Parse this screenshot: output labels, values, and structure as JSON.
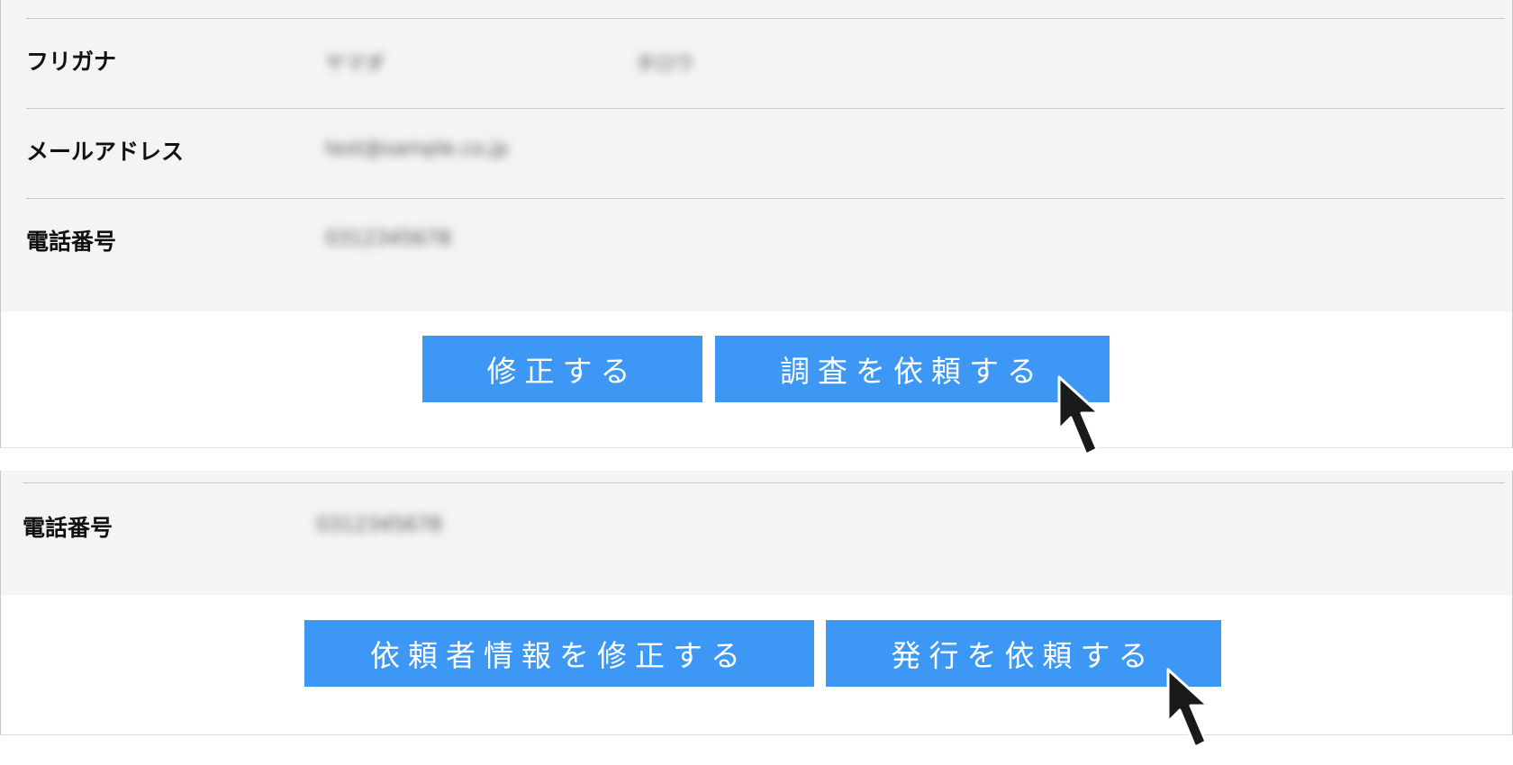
{
  "top_panel": {
    "rows": [
      {
        "label": "フリガナ",
        "value_1": "ヤマダ",
        "value_2": "タロウ"
      },
      {
        "label": "メールアドレス",
        "value_1": "test@sample.co.jp"
      },
      {
        "label": "電話番号",
        "value_1": "0312345678"
      }
    ],
    "buttons": {
      "edit_label": "修正する",
      "request_survey_label": "調査を依頼する"
    }
  },
  "bottom_panel": {
    "rows": [
      {
        "label": "電話番号",
        "value_1": "0312345678"
      }
    ],
    "buttons": {
      "edit_requester_label": "依頼者情報を修正する",
      "request_issue_label": "発行を依頼する"
    }
  },
  "colors": {
    "button_bg": "#3d98f5",
    "info_bg": "#f4f4f4",
    "cursor": "#1a1a1a"
  },
  "icons": {
    "cursor": "mouse-pointer-icon"
  }
}
